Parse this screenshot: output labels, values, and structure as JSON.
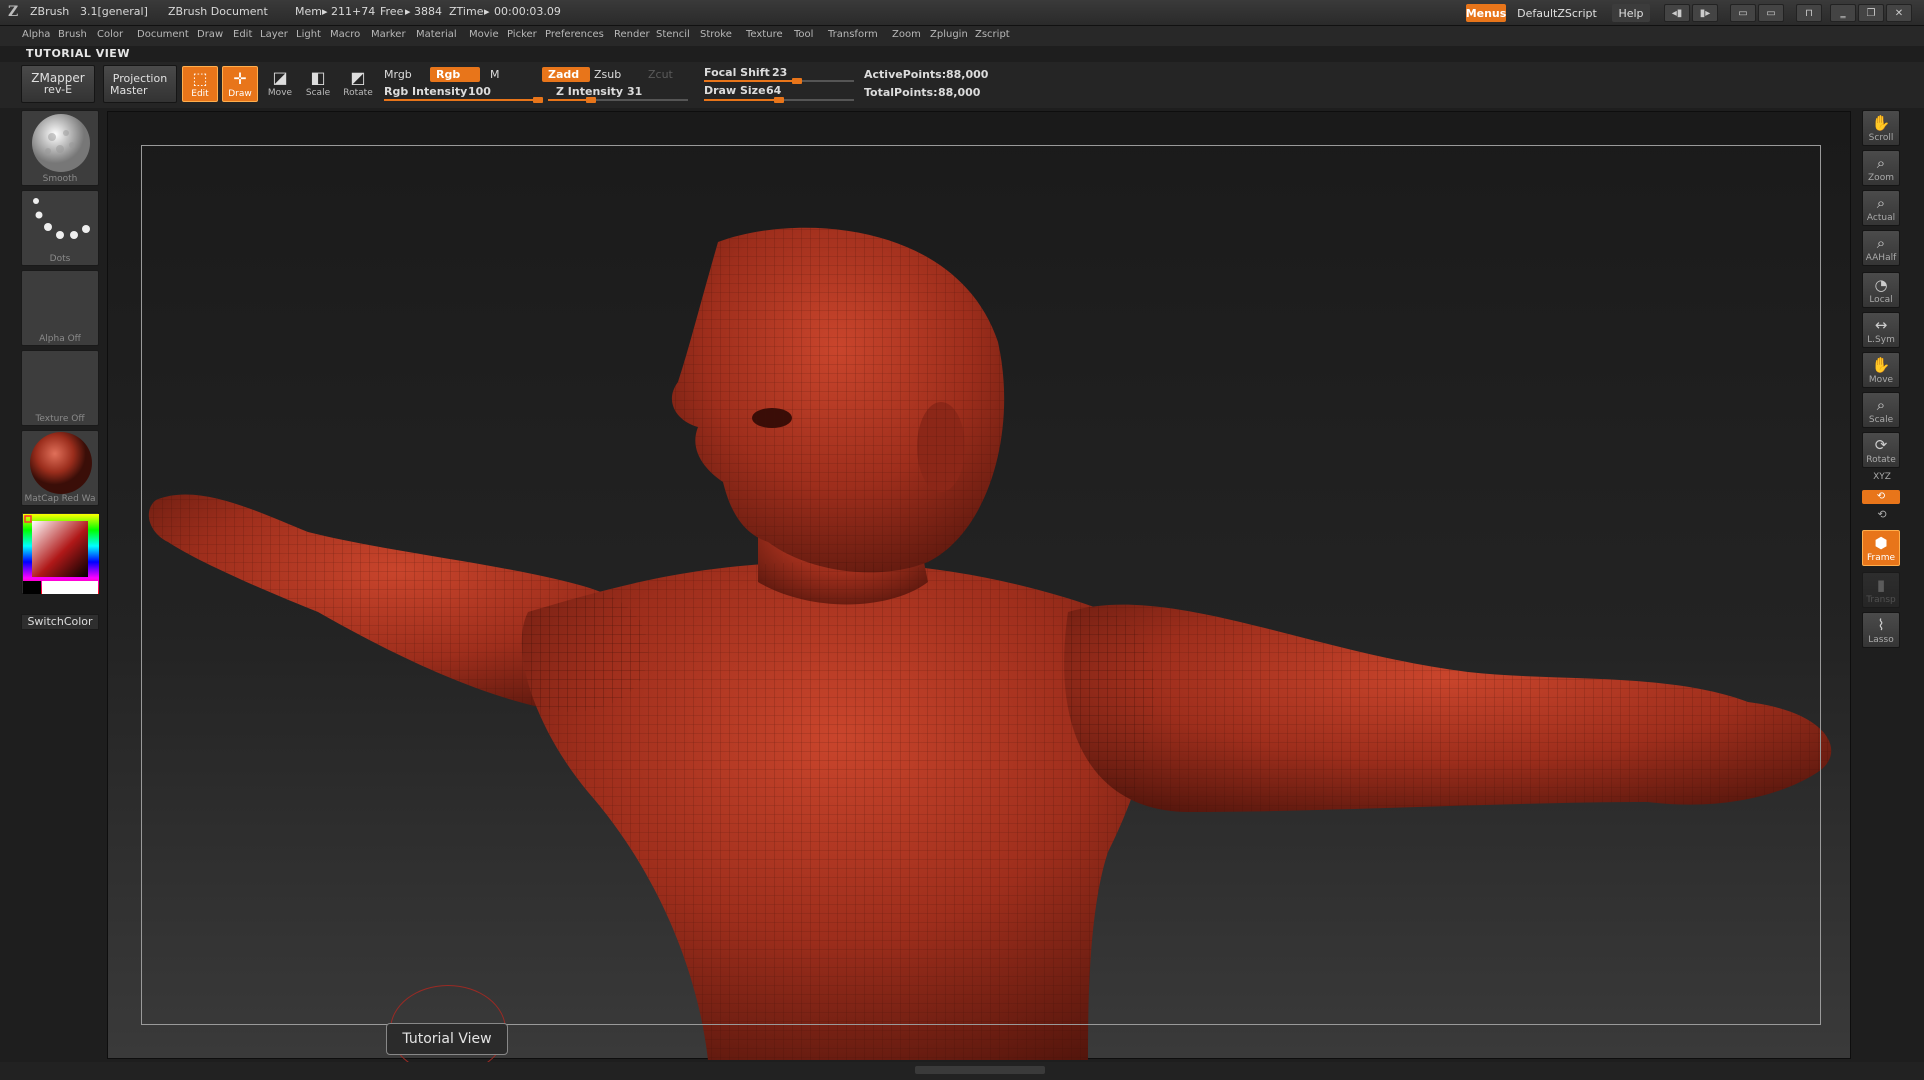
{
  "titlebar": {
    "app": "ZBrush",
    "version": "3.1[general]",
    "document": "ZBrush Document",
    "mem_label": "Mem",
    "mem_value": "211+74",
    "free_label": "Free",
    "free_value": "3884",
    "ztime_label": "ZTime",
    "ztime_value": "00:00:03.09",
    "menus_label": "Menus",
    "script_label": "DefaultZScript",
    "help_label": "Help"
  },
  "menubar": {
    "items": [
      "Alpha",
      "Brush",
      "Color",
      "Document",
      "Draw",
      "Edit",
      "Layer",
      "Light",
      "Macro",
      "Marker",
      "Material",
      "Movie",
      "Picker",
      "Preferences",
      "Render",
      "Stencil",
      "Stroke",
      "Texture",
      "Tool",
      "Transform",
      "Zoom",
      "Zplugin",
      "Zscript"
    ]
  },
  "view_title": "TUTORIAL VIEW",
  "toolbar": {
    "zmapper_line1": "ZMapper",
    "zmapper_line2": "rev-E",
    "projection_line1": "Projection",
    "projection_line2": "Master",
    "edit_label": "Edit",
    "draw_label": "Draw",
    "move_label": "Move",
    "scale_label": "Scale",
    "rotate_label": "Rotate",
    "mrgb_label": "Mrgb",
    "rgb_label": "Rgb",
    "m_label": "M",
    "rgb_intensity_label": "Rgb Intensity",
    "rgb_intensity_value": "100",
    "zadd_label": "Zadd",
    "zsub_label": "Zsub",
    "zcut_label": "Zcut",
    "z_intensity_label": "Z Intensity",
    "z_intensity_value": "31",
    "focal_shift_label": "Focal Shift",
    "focal_shift_value": "23",
    "draw_size_label": "Draw Size",
    "draw_size_value": "64",
    "active_points_label": "ActivePoints:",
    "active_points_value": "88,000",
    "total_points_label": "TotalPoints:",
    "total_points_value": "88,000"
  },
  "slider_levels": {
    "rgb_intensity": 1.0,
    "z_intensity": 0.31,
    "focal_shift": 0.62,
    "draw_size": 0.5
  },
  "left_shelf": {
    "brush_label": "Smooth",
    "stroke_label": "Dots",
    "alpha_label": "Alpha Off",
    "texture_label": "Texture Off",
    "material_label": "MatCap Red Wa",
    "switch_color_label": "SwitchColor"
  },
  "right_shelf": {
    "scroll": "Scroll",
    "zoom": "Zoom",
    "actual": "Actual",
    "aahalf": "AAHalf",
    "local": "Local",
    "lsym": "L.Sym",
    "move": "Move",
    "scale": "Scale",
    "rotate": "Rotate",
    "xyz": "XYZ",
    "frame": "Frame",
    "transp": "Transp",
    "lasso": "Lasso"
  },
  "tooltip": "Tutorial View",
  "colors": {
    "accent": "#e8751a",
    "model": "#a5301e",
    "background": "#1e1e1e"
  }
}
